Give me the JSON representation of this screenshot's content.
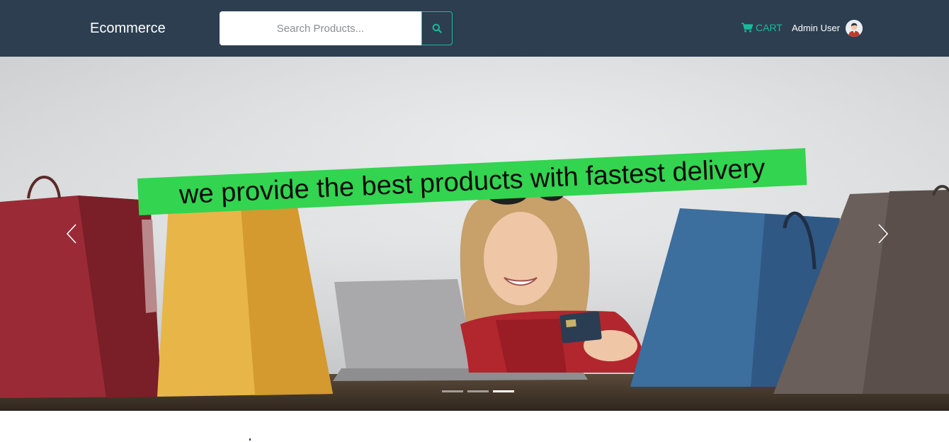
{
  "header": {
    "brand": "Ecommerce",
    "search": {
      "placeholder": "Search Products...",
      "value": "",
      "button_icon": "search-icon"
    },
    "cart": {
      "label": "CART",
      "icon": "shopping-cart-icon"
    },
    "user": {
      "name": "Admin User",
      "avatar_icon": "user-avatar-icon"
    }
  },
  "carousel": {
    "caption": "we provide the best products with fastest delivery",
    "prev_icon": "chevron-left-icon",
    "next_icon": "chevron-right-icon",
    "slide_count": 3,
    "active_slide": 3
  },
  "colors": {
    "navbar": "#2c3e50",
    "accent": "#18bc9c",
    "caption_band": "#33d44f"
  }
}
